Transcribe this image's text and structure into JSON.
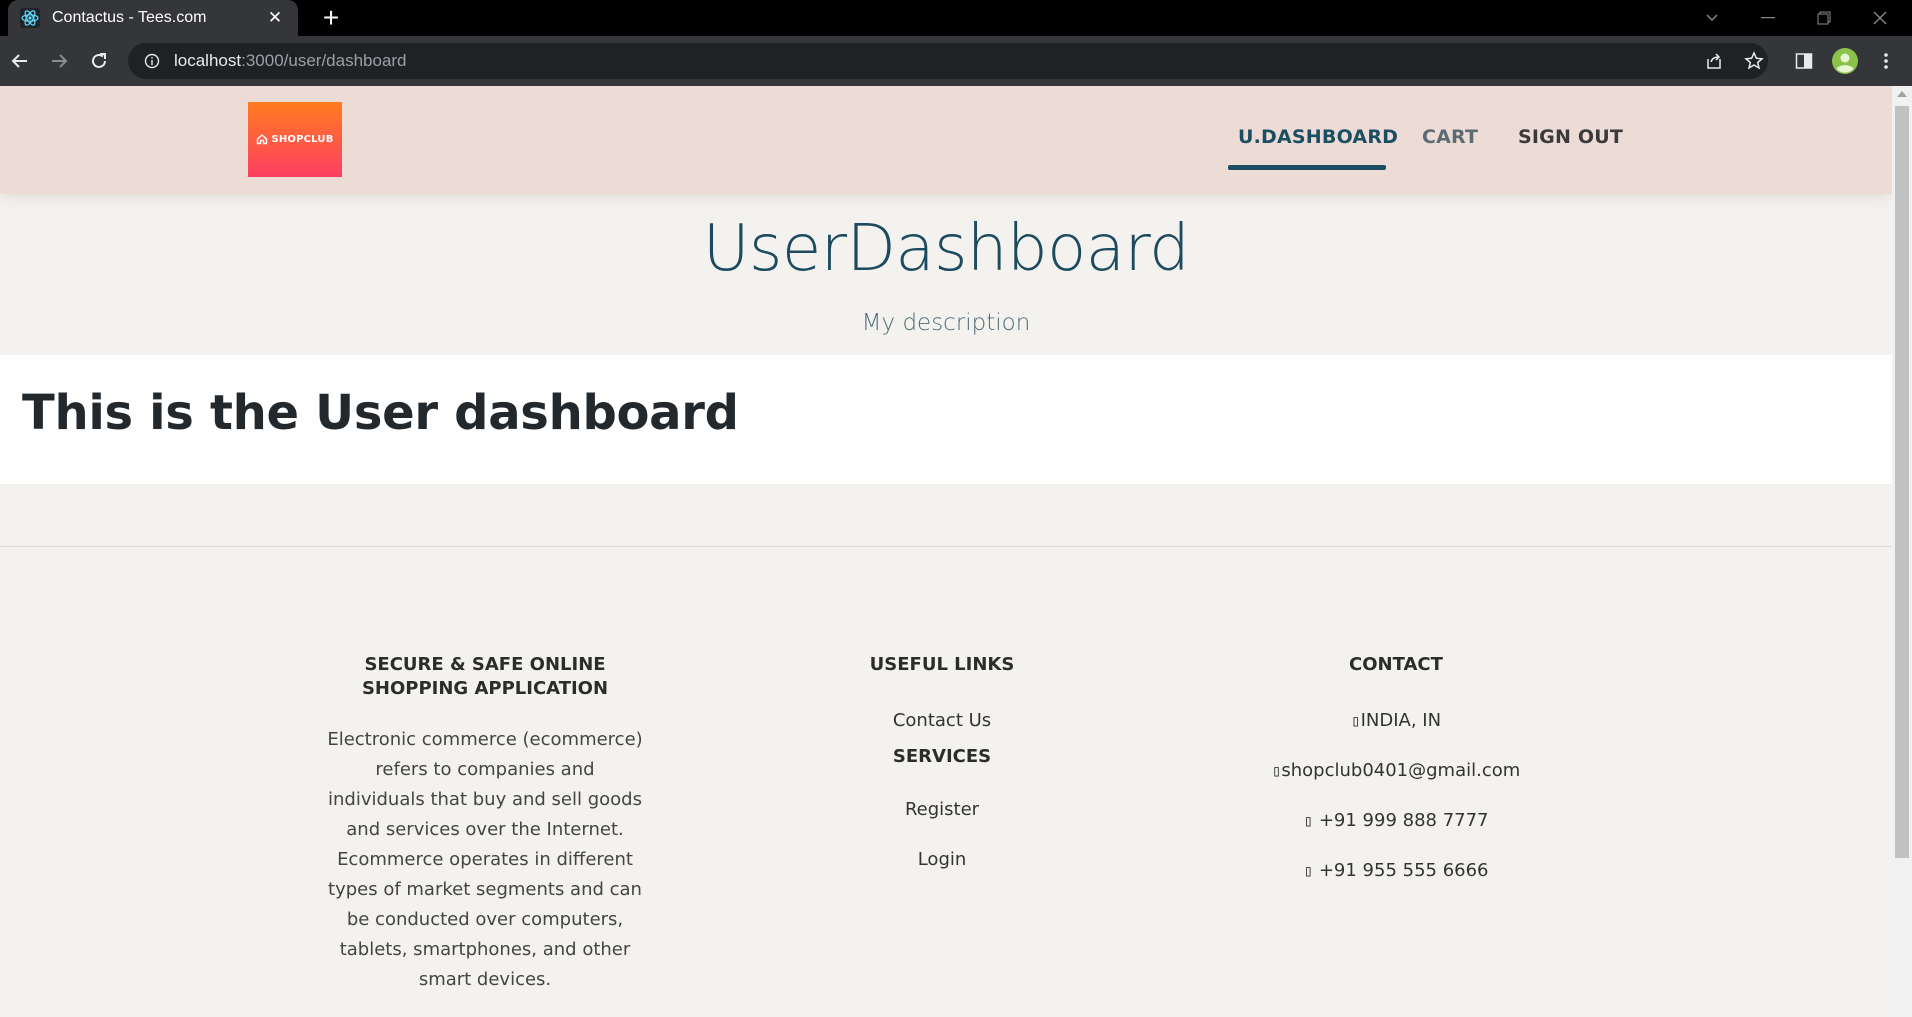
{
  "browser": {
    "tab_title": "Contactus - Tees.com",
    "url_host": "localhost",
    "url_path": ":3000/user/dashboard",
    "icons": [
      "react-favicon-icon",
      "tab-close-icon",
      "new-tab-icon",
      "back-icon",
      "forward-icon",
      "reload-icon",
      "site-info-icon",
      "share-icon",
      "bookmark-star-icon",
      "side-panel-icon",
      "profile-avatar-icon",
      "menu-kebab-icon"
    ]
  },
  "header": {
    "logo_text": "SHOPCLUB",
    "nav": [
      {
        "label": "U.DASHBOARD",
        "active": true
      },
      {
        "label": "CART",
        "active": false
      },
      {
        "label": "SIGN OUT",
        "active": false
      }
    ],
    "accent_color": "#1b4d63"
  },
  "hero": {
    "title": "UserDashboard",
    "description": "My description"
  },
  "main": {
    "heading": "This is the User dashboard"
  },
  "footer": {
    "about": {
      "title": "SECURE & SAFE ONLINE SHOPPING APPLICATION",
      "text": "Electronic commerce (ecommerce) refers to companies and individuals that buy and sell goods and services over the Internet. Ecommerce operates in different types of market segments and can be conducted over computers, tablets, smartphones, and other smart devices."
    },
    "useful_links": {
      "title": "USEFUL LINKS",
      "links": [
        "Contact Us"
      ]
    },
    "services": {
      "title": "SERVICES",
      "links": [
        "Register",
        "Login"
      ]
    },
    "contact": {
      "title": "CONTACT",
      "location": "INDIA, IN",
      "email": "shopclub0401@gmail.com",
      "phone1": " +91 999 888 7777",
      "phone2": " +91 955 555 6666",
      "missing_glyph": "▯"
    }
  }
}
